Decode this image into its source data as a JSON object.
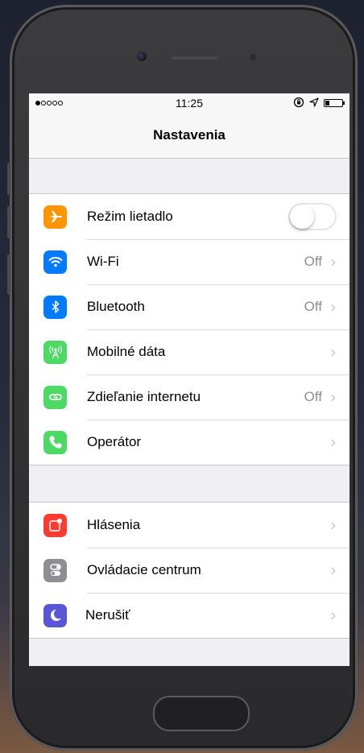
{
  "status": {
    "time": "11:25",
    "signal_filled": 1,
    "signal_total": 5
  },
  "nav": {
    "title": "Nastavenia"
  },
  "colors": {
    "airplane": "#ff9500",
    "wifi": "#007aff",
    "bluetooth": "#007aff",
    "cellular": "#4cd964",
    "hotspot": "#4cd964",
    "carrier": "#4cd964",
    "notifications": "#ff3b30",
    "control_center": "#8e8e93",
    "dnd": "#5856d6"
  },
  "group1": [
    {
      "label": "Režim lietadlo",
      "icon": "airplane-icon",
      "toggle": false
    },
    {
      "label": "Wi-Fi",
      "icon": "wifi-icon",
      "value": "Off"
    },
    {
      "label": "Bluetooth",
      "icon": "bluetooth-icon",
      "value": "Off"
    },
    {
      "label": "Mobilné dáta",
      "icon": "cellular-icon",
      "value": ""
    },
    {
      "label": "Zdieľanie internetu",
      "icon": "hotspot-icon",
      "value": "Off"
    },
    {
      "label": "Operátor",
      "icon": "phone-icon",
      "value": ""
    }
  ],
  "group2": [
    {
      "label": "Hlásenia",
      "icon": "notifications-icon"
    },
    {
      "label": "Ovládacie centrum",
      "icon": "control-center-icon"
    },
    {
      "label": "Nerušiť",
      "icon": "moon-icon"
    }
  ]
}
